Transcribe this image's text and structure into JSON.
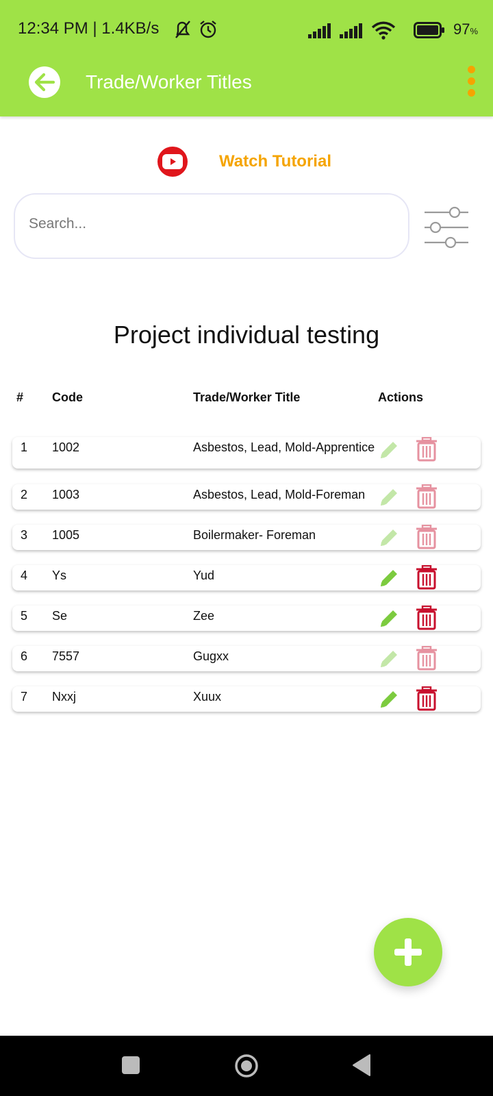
{
  "status_bar": {
    "time": "12:34 PM | 1.4KB/s",
    "battery": "97",
    "battery_unit": "%",
    "icons": [
      "bell-off-icon",
      "alarm-icon",
      "signal-icon",
      "signal-icon",
      "wifi-icon",
      "battery-icon"
    ]
  },
  "toolbar": {
    "title": "Trade/Worker Titles",
    "back_icon": "arrow-left-icon",
    "menu_icon": "more-vertical-icon",
    "menu_color": "#F5A400"
  },
  "tutorial": {
    "label": "Watch Tutorial",
    "icon": "youtube-icon"
  },
  "search": {
    "placeholder": "Search...",
    "value": "",
    "filter_icon": "sliders-icon"
  },
  "project": {
    "title": "Project individual testing"
  },
  "table": {
    "headers": {
      "num": "#",
      "code": "Code",
      "title": "Trade/Worker Title",
      "actions": "Actions"
    },
    "rows": [
      {
        "num": "1",
        "code": "1002",
        "title": "Asbestos, Lead, Mold-Apprentice",
        "enabled": false
      },
      {
        "num": "2",
        "code": "1003",
        "title": "Asbestos, Lead, Mold-Foreman",
        "enabled": false
      },
      {
        "num": "3",
        "code": "1005",
        "title": "Boilermaker- Foreman",
        "enabled": false
      },
      {
        "num": "4",
        "code": "Ys",
        "title": "Yud",
        "enabled": true
      },
      {
        "num": "5",
        "code": "Se",
        "title": "Zee",
        "enabled": true
      },
      {
        "num": "6",
        "code": "7557",
        "title": "Gugxx",
        "enabled": false
      },
      {
        "num": "7",
        "code": "Nxxj",
        "title": "Xuux",
        "enabled": true
      }
    ]
  },
  "fab": {
    "icon": "plus-icon"
  },
  "colors": {
    "primary": "#9FE247",
    "accent": "#F5A400",
    "edit": "#7CCB3F",
    "delete": "#C8102E"
  },
  "nav_bar": {
    "icons": [
      "recents-square-icon",
      "home-circle-icon",
      "back-triangle-icon"
    ]
  }
}
